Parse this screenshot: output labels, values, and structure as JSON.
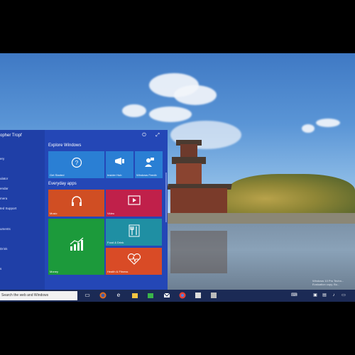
{
  "start_menu": {
    "user": "opher Tropf",
    "left_items": [
      "ery",
      "ulator",
      "endar",
      "mera",
      "ted Support",
      "uments",
      "Drink",
      "s"
    ],
    "sections": {
      "explore": "Explore Windows",
      "everyday": "Everyday apps"
    },
    "tiles": [
      {
        "label": "Get Started",
        "icon": "help-icon",
        "color": "#2a7fd4"
      },
      {
        "label": "Insider Hub",
        "icon": "megaphone-icon",
        "color": "#2a7fd4"
      },
      {
        "label": "Windows Feedb",
        "icon": "feedback-icon",
        "color": "#2a7fd4"
      },
      {
        "label": "Music",
        "icon": "headphones-icon",
        "color": "#d04e23"
      },
      {
        "label": "Video",
        "icon": "video-icon",
        "color": "#c0204a"
      },
      {
        "label": "Money",
        "icon": "chart-icon",
        "color": "#1c9a3b"
      },
      {
        "label": "Food & Drink",
        "icon": "utensils-icon",
        "color": "#1f8fa3"
      },
      {
        "label": "Health & Fitness",
        "icon": "heart-icon",
        "color": "#d94b26"
      }
    ]
  },
  "taskbar": {
    "search_placeholder": "Search the web and Windows",
    "icons": [
      "task-view-icon",
      "firefox-icon",
      "edge-icon",
      "explorer-icon",
      "store-icon",
      "mail-icon",
      "chrome-icon",
      "media-icon",
      "settings-icon"
    ]
  },
  "desktop": {
    "watermark": "Windows 10 Pro Techn... Evaluation copy. Bu..."
  }
}
